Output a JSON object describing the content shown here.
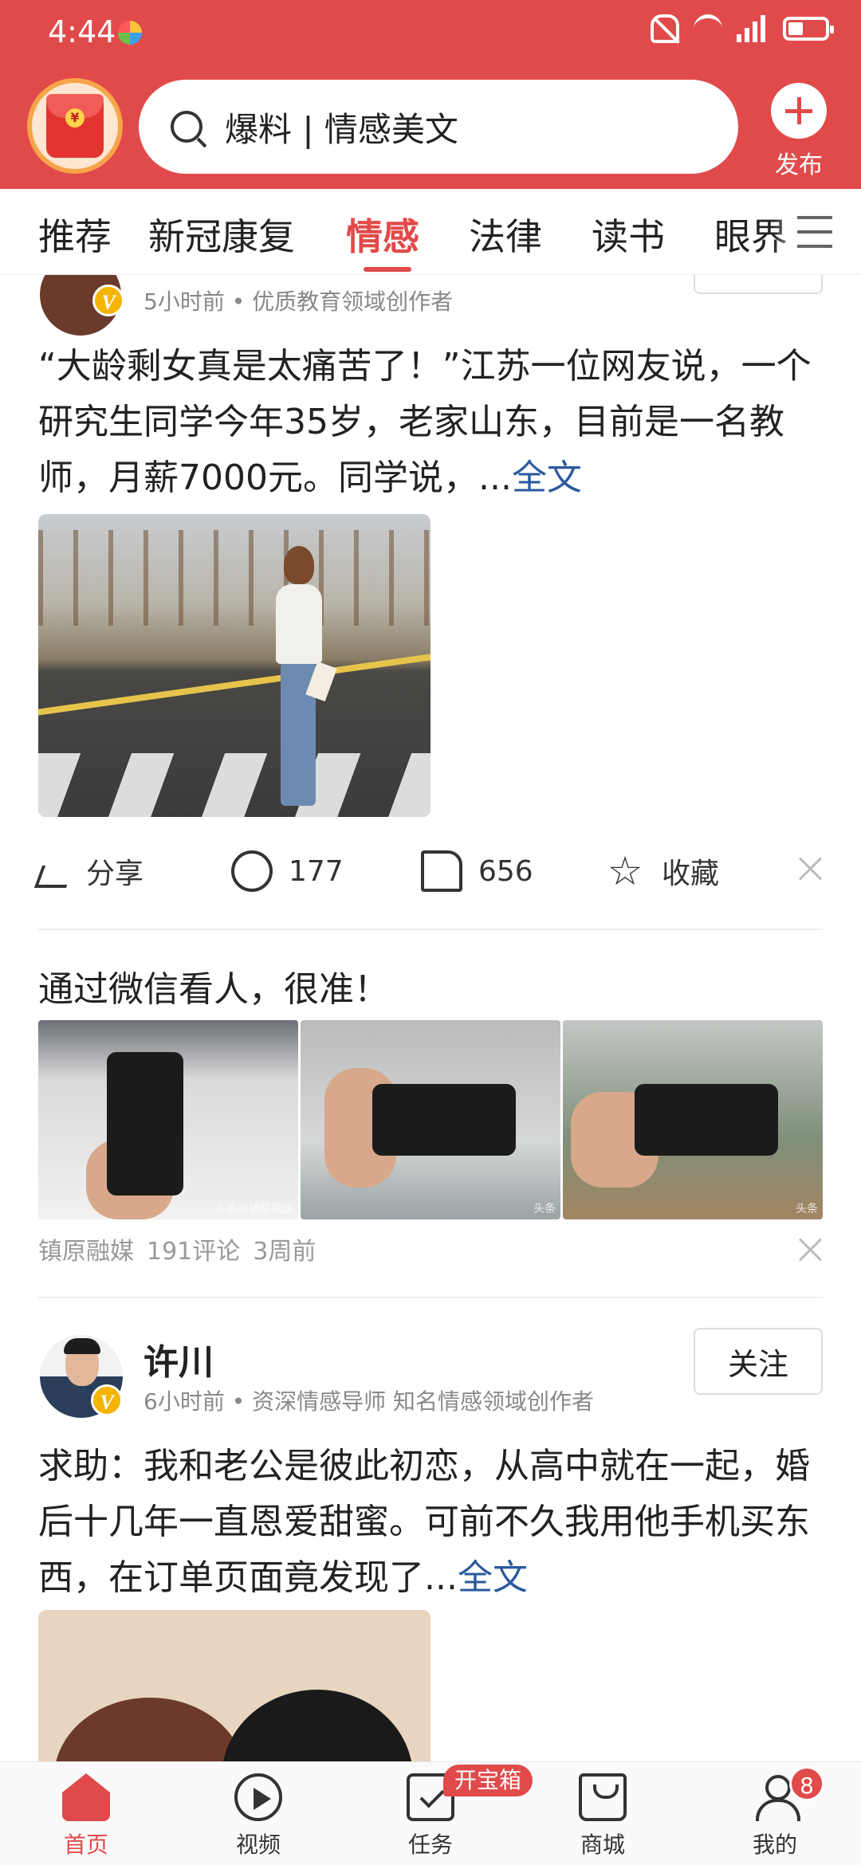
{
  "status_bar": {
    "time": "4:44",
    "network": "4G"
  },
  "header": {
    "search_text": "爆料 | 情感美文",
    "publish_label": "发布"
  },
  "tabs": [
    {
      "label": "推荐"
    },
    {
      "label": "新冠康复"
    },
    {
      "label": "情感",
      "active": true
    },
    {
      "label": "法律"
    },
    {
      "label": "读书"
    },
    {
      "label": "眼界"
    }
  ],
  "post1": {
    "meta": "5小时前 • 优质教育领域创作者",
    "text": "“大龄剩女真是太痛苦了！”江苏一位网友说，一个研究生同学今年35岁，老家山东，目前是一名教师，月薪7000元。同学说，...",
    "more_label": "全文",
    "share_label": "分享",
    "comment_count": "177",
    "like_count": "656",
    "collect_label": "收藏"
  },
  "article": {
    "title": "通过微信看人，很准！",
    "source": "镇原融媒",
    "comments": "191评论",
    "time": "3周前",
    "watermarks": [
      "头条@镇原融媒",
      "头条",
      "头条"
    ]
  },
  "post2": {
    "author": "许川",
    "follow_label": "关注",
    "meta": "6小时前 • 资深情感导师 知名情感领域创作者",
    "text": "求助：我和老公是彼此初恋，从高中就在一起，婚后十几年一直恩爱甜蜜。可前不久我用他手机买东西，在订单页面竟发现了...",
    "more_label": "全文"
  },
  "bottom_nav": {
    "items": [
      {
        "label": "首页",
        "active": true
      },
      {
        "label": "视频"
      },
      {
        "label": "任务"
      },
      {
        "label": "商城"
      },
      {
        "label": "我的"
      }
    ],
    "task_badge": "开宝箱",
    "me_badge": "8"
  },
  "colors": {
    "accent": "#e14a4a",
    "link": "#2a5a9e",
    "verified": "#f5b400"
  }
}
